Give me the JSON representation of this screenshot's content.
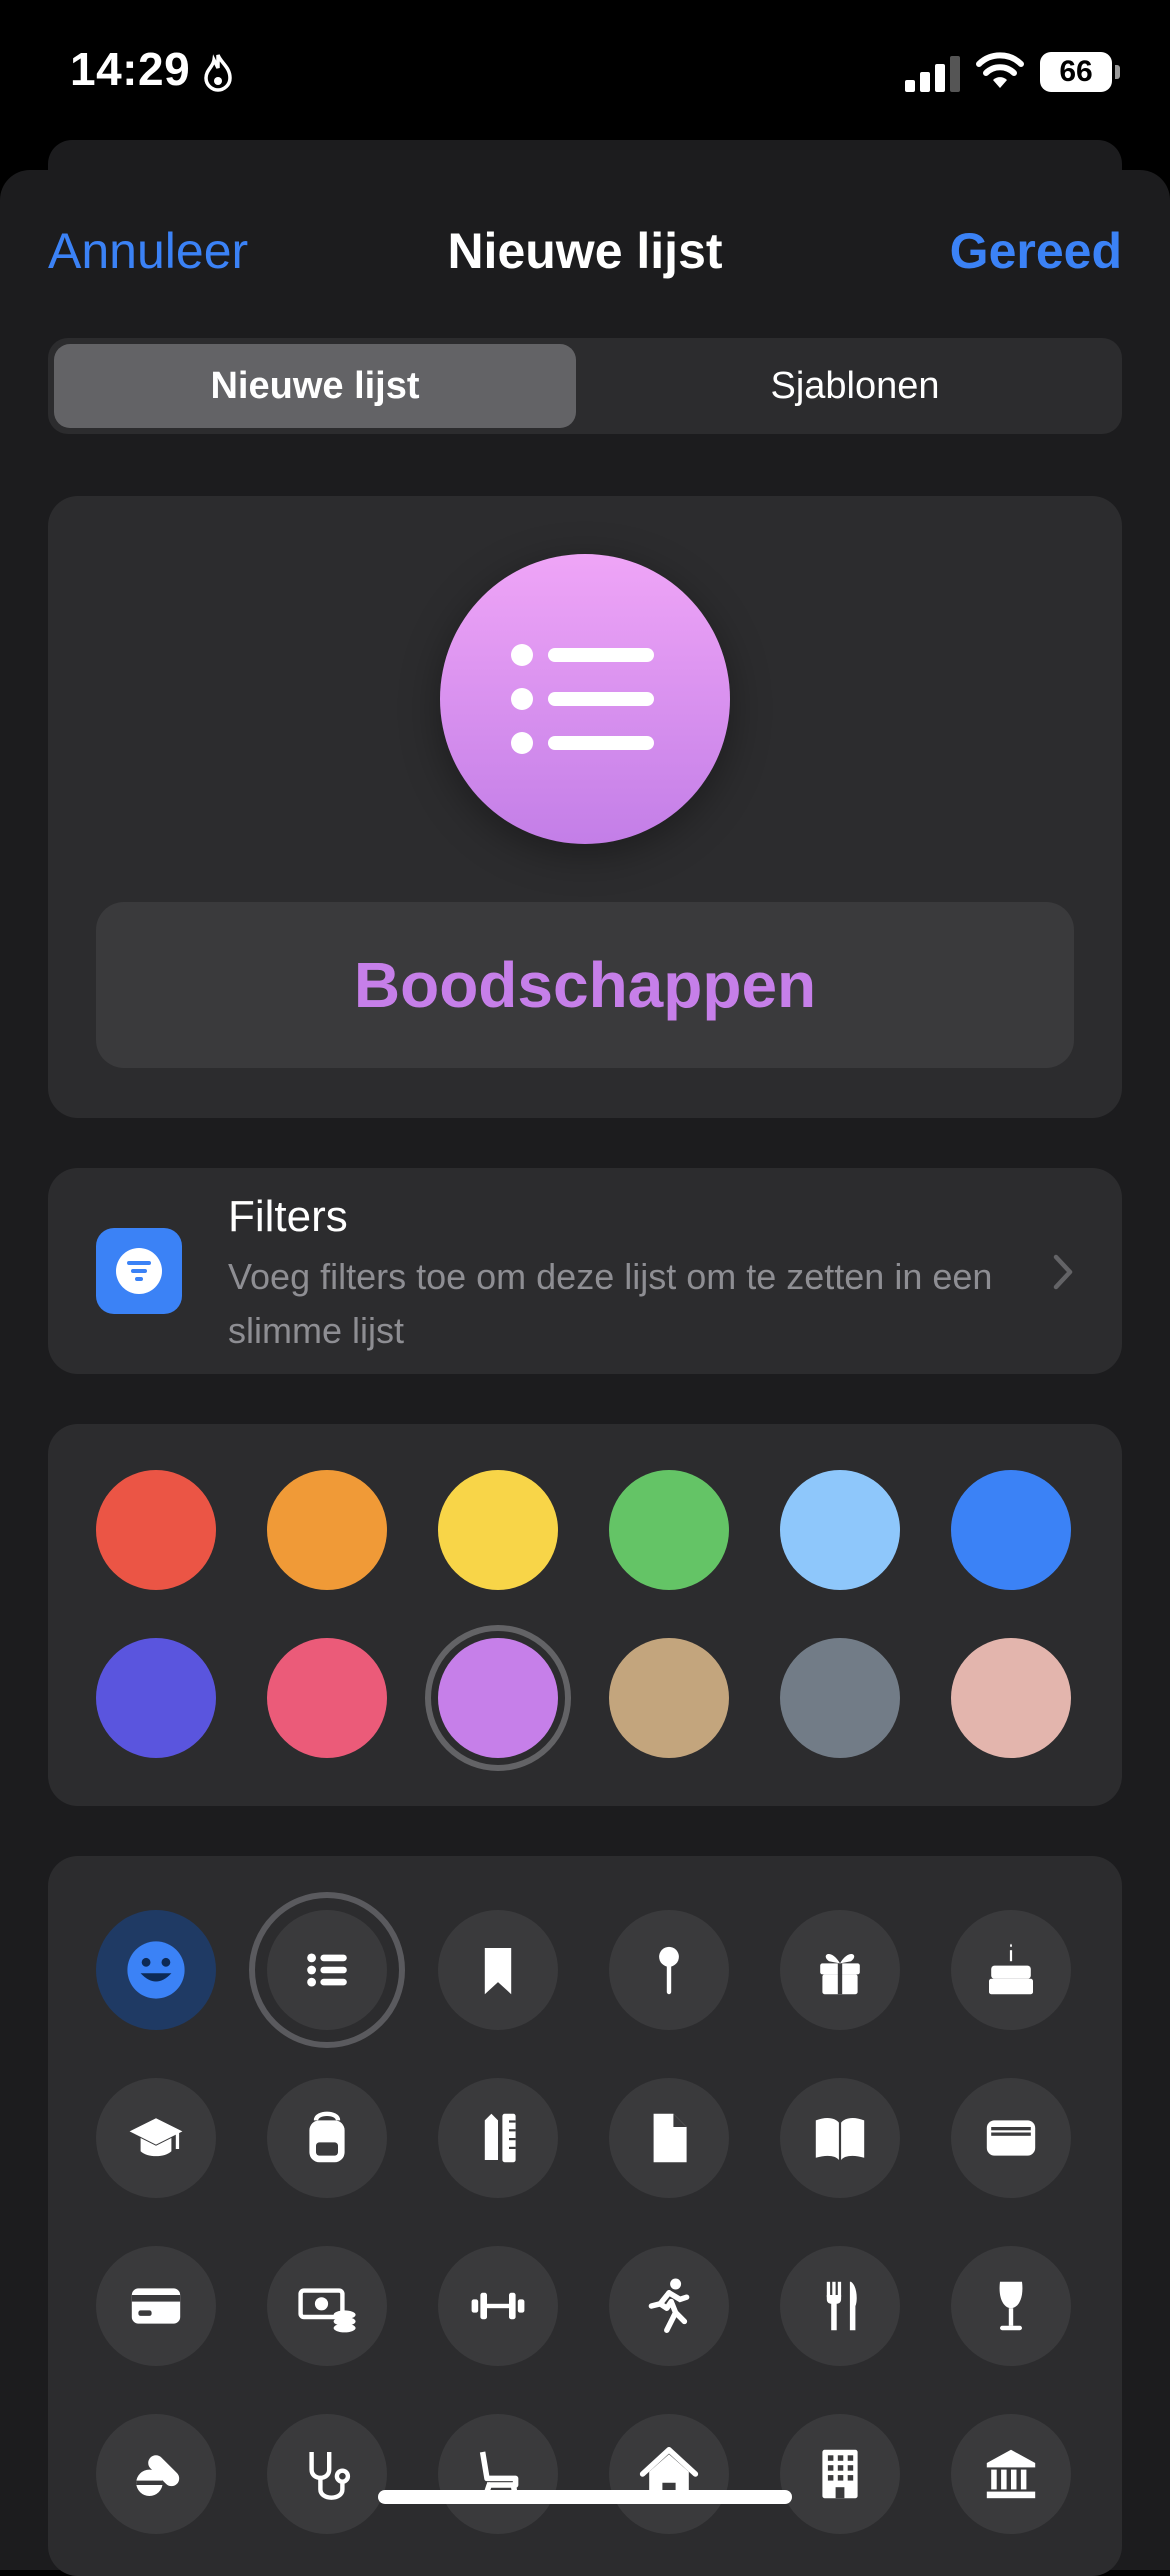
{
  "status_bar": {
    "time": "14:29",
    "battery": "66"
  },
  "nav": {
    "cancel": "Annuleer",
    "title": "Nieuwe lijst",
    "done": "Gereed"
  },
  "segments": [
    "Nieuwe lijst",
    "Sjablonen"
  ],
  "list": {
    "name": "Boodschappen",
    "icon": "list-bullet-icon",
    "color": "#c67fe9"
  },
  "filters": {
    "title": "Filters",
    "description": "Voeg filters toe om deze lijst om te zetten in een slimme lijst"
  },
  "colors": [
    "#eb5545",
    "#f09a37",
    "#f8d548",
    "#64c466",
    "#8ec7fb",
    "#3b82f6",
    "#5a55de",
    "#eb5b79",
    "#c67fe9",
    "#c3a57d",
    "#727c87",
    "#e3b5ad"
  ],
  "selected_color_index": 8,
  "glyphs": [
    "smiley-icon",
    "list-bullet-icon",
    "bookmark-icon",
    "pin-icon",
    "gift-icon",
    "birthday-cake-icon",
    "graduation-cap-icon",
    "backpack-icon",
    "pencil-ruler-icon",
    "document-icon",
    "book-icon",
    "wallet-icon",
    "credit-card-icon",
    "money-icon",
    "dumbbell-icon",
    "running-figure-icon",
    "fork-knife-icon",
    "wine-glass-icon",
    "pills-icon",
    "stethoscope-icon",
    "chair-icon",
    "house-icon",
    "building-icon",
    "bank-icon"
  ],
  "selected_glyph_index": 1
}
